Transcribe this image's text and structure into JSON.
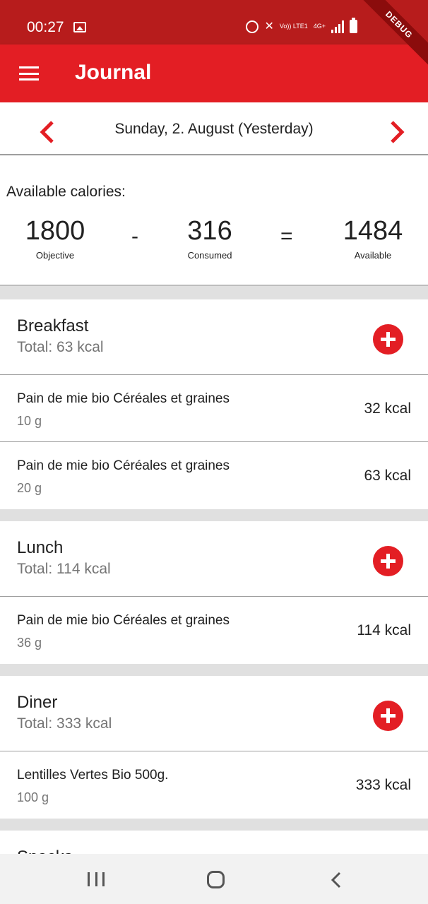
{
  "status_bar": {
    "time": "00:27",
    "volte": "Vo)) LTE1",
    "network": "4G+",
    "icons": [
      "image-icon",
      "alarm-icon",
      "mute-icon",
      "volte-icon",
      "network-icon",
      "signal-icon",
      "battery-icon"
    ]
  },
  "debug_banner": "DEBUG",
  "app_bar": {
    "title": "Journal",
    "menu_icon": "hamburger-menu-icon"
  },
  "date_nav": {
    "label": "Sunday, 2. August (Yesterday)",
    "prev_icon": "chevron-left-icon",
    "next_icon": "chevron-right-icon"
  },
  "calories": {
    "heading": "Available calories:",
    "objective_value": "1800",
    "objective_label": "Objective",
    "minus": "-",
    "consumed_value": "316",
    "consumed_label": "Consumed",
    "equals": "=",
    "available_value": "1484",
    "available_label": "Available"
  },
  "meals": {
    "breakfast": {
      "name": "Breakfast",
      "total": "Total: 63 kcal",
      "items": [
        {
          "name": "Pain de mie bio Céréales et graines",
          "qty": "10 g",
          "kcal": "32 kcal"
        },
        {
          "name": "Pain de mie bio Céréales et graines",
          "qty": "20 g",
          "kcal": "63 kcal"
        }
      ]
    },
    "lunch": {
      "name": "Lunch",
      "total": "Total: 114 kcal",
      "items": [
        {
          "name": "Pain de mie bio Céréales et graines",
          "qty": "36 g",
          "kcal": "114 kcal"
        }
      ]
    },
    "diner": {
      "name": "Diner",
      "total": "Total: 333 kcal",
      "items": [
        {
          "name": "Lentilles Vertes Bio 500g.",
          "qty": "100 g",
          "kcal": "333 kcal"
        }
      ]
    },
    "snacks": {
      "name": "Snacks"
    }
  },
  "colors": {
    "primary": "#e31e24",
    "status_bar": "#b71c1c",
    "secondary_text": "#757575",
    "divider": "#9e9e9e",
    "background": "#e0e0e0"
  },
  "nav_bar": {
    "icons": [
      "recent-apps-icon",
      "home-icon",
      "back-icon"
    ]
  }
}
